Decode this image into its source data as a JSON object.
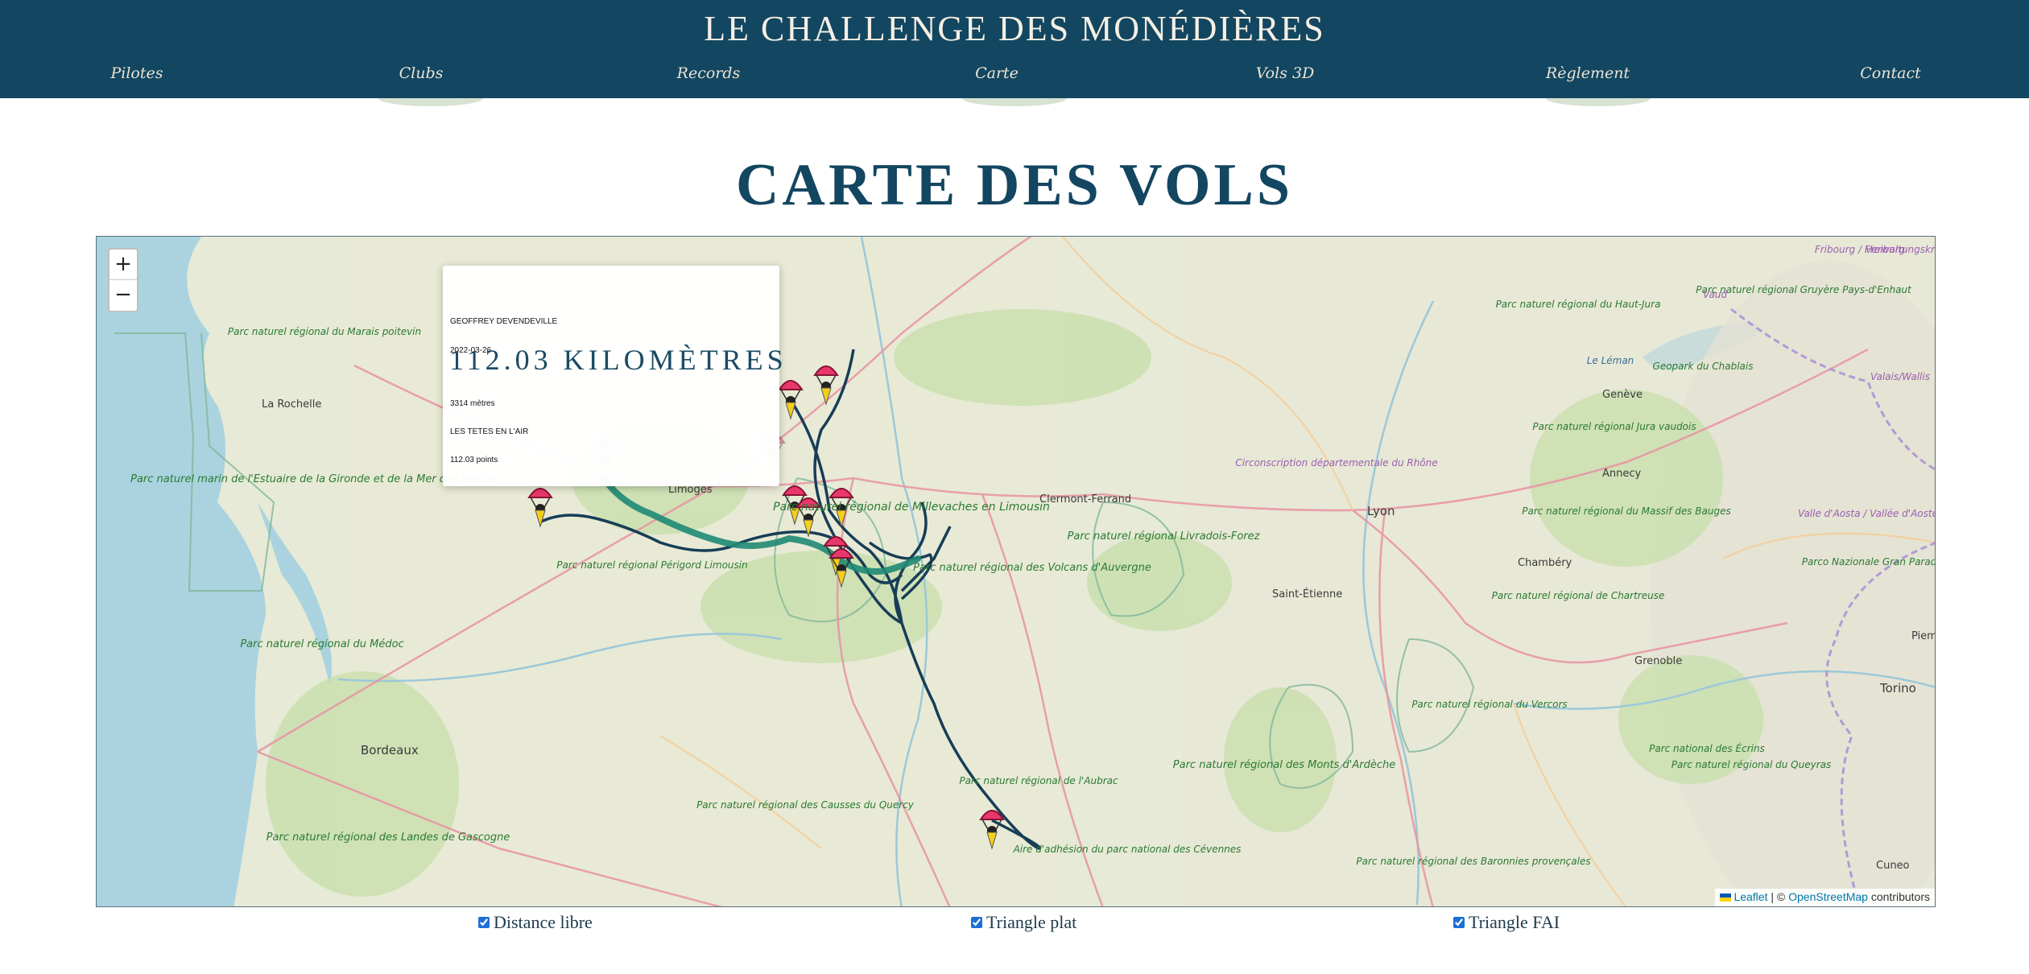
{
  "header": {
    "site_title": "LE CHALLENGE DES MONÉDIÈRES",
    "nav": [
      "Pilotes",
      "Clubs",
      "Records",
      "Carte",
      "Vols 3D",
      "Règlement",
      "Contact"
    ]
  },
  "page": {
    "heading": "CARTE DES VOLS"
  },
  "map": {
    "zoom_in": "+",
    "zoom_out": "−",
    "popup": {
      "pilot": "GEOFFREY DEVENDEVILLE",
      "date": "2022-03-26",
      "distance": "112.03 KILOMÈTRES",
      "altitude": "3314 mètres",
      "club": "LES TETES EN L'AIR",
      "points": "112.03 points"
    },
    "labels": [
      "La Rochelle",
      "Parc naturel régional du Marais poitevin",
      "Parc naturel marin de l'Estuaire de la Gironde et de la Mer des Pertuis",
      "Limoges",
      "Parc naturel régional de Millevaches en Limousin",
      "Parc naturel régional Périgord Limousin",
      "Clermont-Ferrand",
      "Parc naturel régional Livradois-Forez",
      "Parc naturel régional des Volcans d'Auvergne",
      "Lyon",
      "Saint-Étienne",
      "Circonscription départementale du Rhône",
      "Annecy",
      "Genève",
      "Le Léman",
      "Geopark du Chablais",
      "Parc naturel régional du Haut-Jura",
      "Parc naturel régional Gruyère Pays-d'Enhaut",
      "Fribourg / Freiburg",
      "Vaud",
      "Valais/Wallis",
      "Valle d'Aosta / Vallée d'Aoste",
      "Parco Nazionale Gran Paradiso",
      "Parc naturel régional du Massif des Bauges",
      "Chambéry",
      "Parc naturel régional de Chartreuse",
      "Grenoble",
      "Parc naturel régional du Vercors",
      "Parc national des Écrins",
      "Parc naturel régional du Queyras",
      "Torino",
      "Piemo",
      "Cuneo",
      "Parc naturel régional des Monts d'Ardèche",
      "Parc naturel régional des Baronnies provençales",
      "Aire d'adhésion du parc national des Cévennes",
      "Parc naturel régional de l'Aubrac",
      "Parc naturel régional des Causses du Quercy",
      "Parc naturel régional du Médoc",
      "Bordeaux",
      "Parc naturel régional des Landes de Gascogne",
      "Verwaltungskreis Ober",
      "Parc naturel régional Jura vaudois"
    ],
    "attribution": {
      "leaflet": "Leaflet",
      "osm": "OpenStreetMap",
      "separator": "| ©",
      "suffix": "contributors"
    }
  },
  "filters": [
    {
      "label": "Distance libre",
      "checked": true
    },
    {
      "label": "Triangle plat",
      "checked": true
    },
    {
      "label": "Triangle FAI",
      "checked": true
    }
  ]
}
